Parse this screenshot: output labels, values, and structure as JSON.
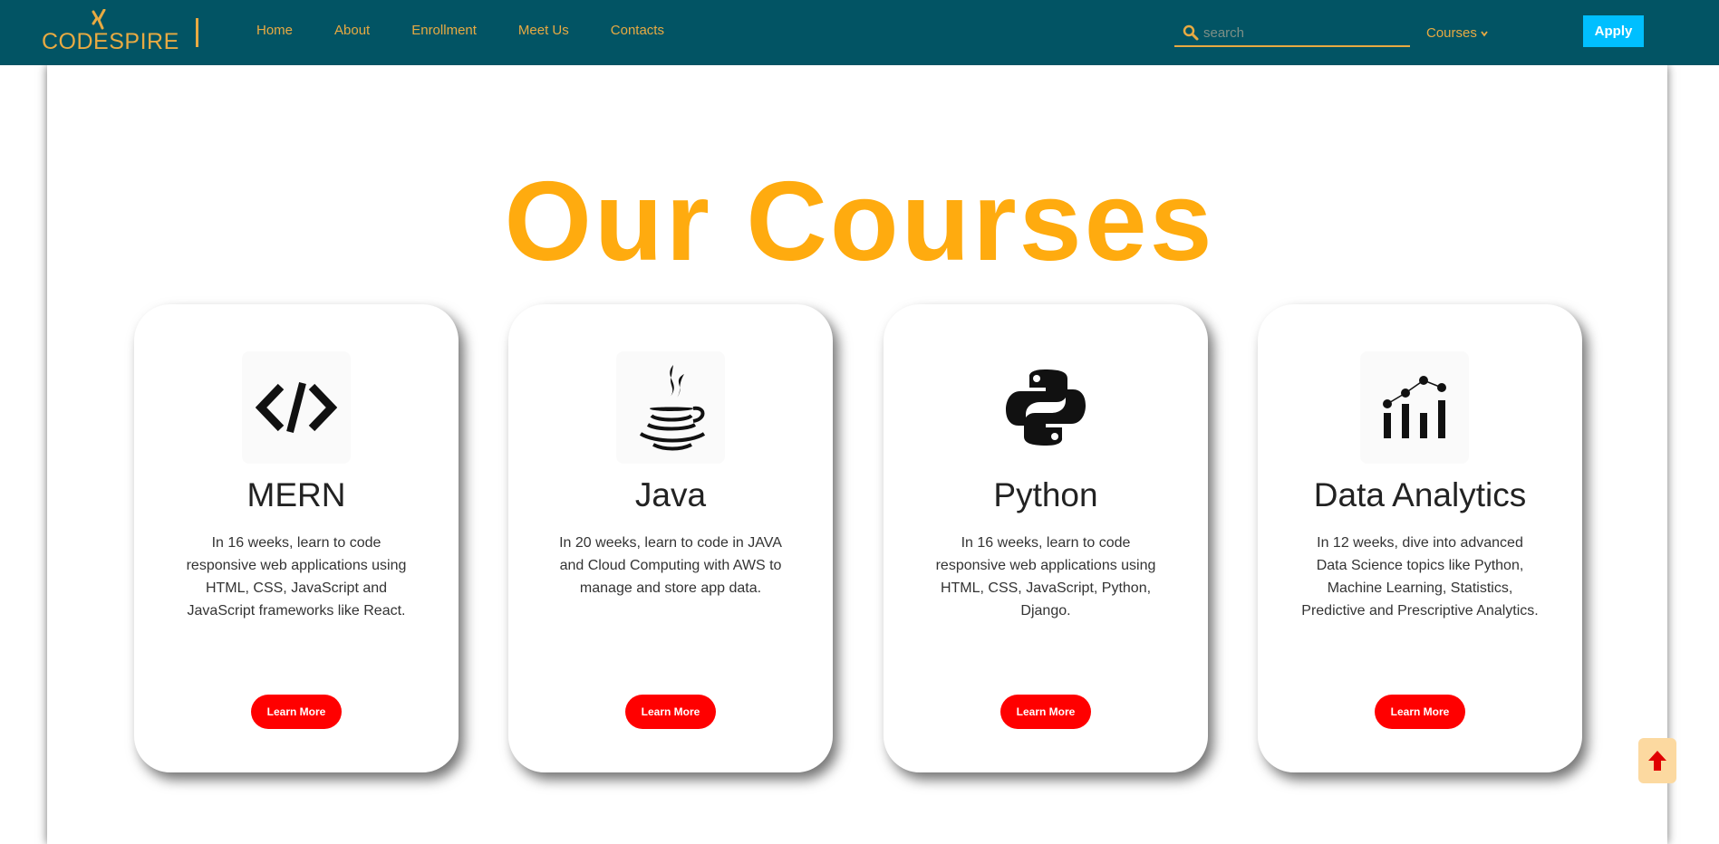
{
  "brand": {
    "name": "CODESPIRE",
    "logo_icon": "xing-logo-icon"
  },
  "nav": {
    "links": [
      "Home",
      "About",
      "Enrollment",
      "Meet Us",
      "Contacts"
    ]
  },
  "search": {
    "placeholder": "search",
    "value": ""
  },
  "courses_menu": {
    "label": "Courses"
  },
  "apply_label": "Apply",
  "page_title": "Our Courses",
  "cards": [
    {
      "icon": "code-icon",
      "title": "MERN",
      "description": "In 16 weeks, learn to code responsive web applications using HTML, CSS, JavaScript and JavaScript frameworks like React.",
      "button": "Learn More"
    },
    {
      "icon": "java-icon",
      "title": "Java",
      "description": "In 20 weeks, learn to code in JAVA and Cloud Computing with AWS to manage and store app data.",
      "button": "Learn More"
    },
    {
      "icon": "python-icon",
      "title": "Python",
      "description": "In 16 weeks, learn to code responsive web applications using HTML, CSS, JavaScript, Python, Django.",
      "button": "Learn More"
    },
    {
      "icon": "analytics-chart-icon",
      "title": "Data Analytics",
      "description": "In 12 weeks, dive into advanced Data Science topics like Python, Machine Learning, Statistics, Predictive and Prescriptive Analytics.",
      "button": "Learn More"
    }
  ],
  "back_to_top_icon": "arrow-up-icon",
  "colors": {
    "navbar_bg": "#025464",
    "nav_text": "#E8AA42",
    "title": "#FFAB0F",
    "apply_bg": "#00BFFF",
    "learn_more_bg": "#FF0000",
    "back_to_top_bg": "#FCD9A0"
  }
}
